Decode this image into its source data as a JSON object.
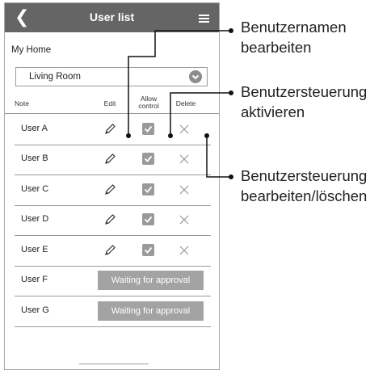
{
  "header": {
    "back_icon": "chevron-left-icon",
    "title": "User list",
    "menu_icon": "hamburger-menu-icon"
  },
  "home": {
    "label": "My Home"
  },
  "room_select": {
    "value": "Living Room",
    "icon": "chevron-down-circle-icon"
  },
  "columns": {
    "note": "Note",
    "edit": "Edit",
    "allow_line1": "Allow",
    "allow_line2": "control",
    "delete": "Delete"
  },
  "users": [
    {
      "name": "User A",
      "status": "active"
    },
    {
      "name": "User B",
      "status": "active"
    },
    {
      "name": "User C",
      "status": "active"
    },
    {
      "name": "User D",
      "status": "active"
    },
    {
      "name": "User E",
      "status": "active"
    },
    {
      "name": "User F",
      "status": "waiting",
      "waiting_label": "Waiting for approval"
    },
    {
      "name": "User G",
      "status": "waiting",
      "waiting_label": "Waiting for approval"
    }
  ],
  "callouts": {
    "edit_line1": "Benutzernamen",
    "edit_line2": "bearbeiten",
    "allow_line1": "Benutzersteuerung",
    "allow_line2": "aktivieren",
    "delete_line1": "Benutzersteuerung",
    "delete_line2": "bearbeiten/löschen"
  },
  "colors": {
    "title_bar": "#656565",
    "waiting_button": "#a3a3a3",
    "checkbox": "#9a9a9a"
  }
}
